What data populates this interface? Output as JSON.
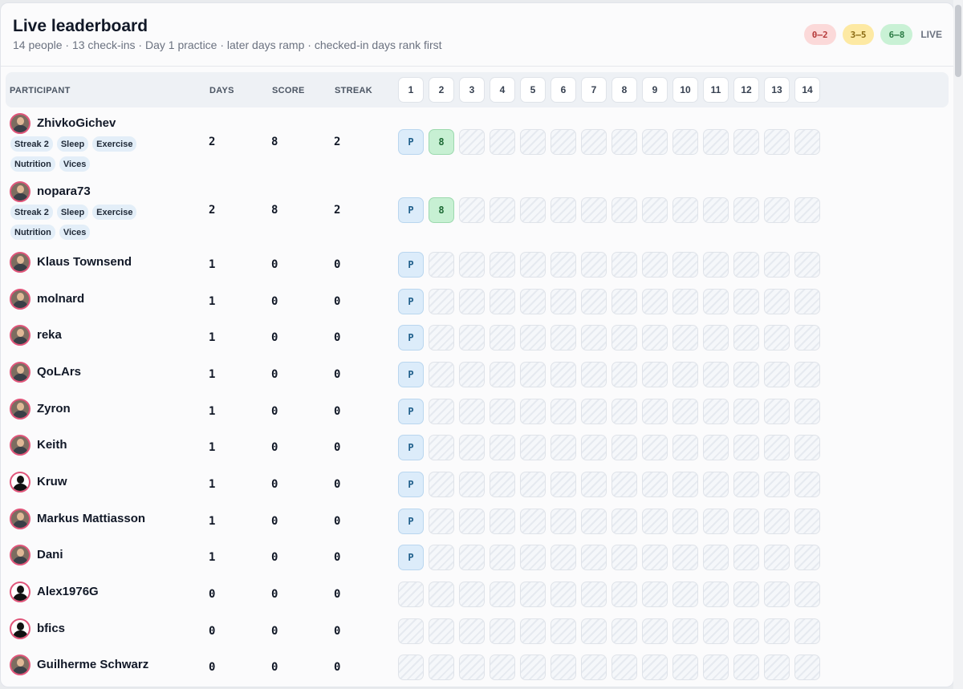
{
  "header": {
    "title": "Live leaderboard",
    "subtitle": "14 people · 13 check-ins · Day 1 practice · later days ramp · checked-in days rank first"
  },
  "legend": {
    "ranges": [
      {
        "label": "0–2",
        "color": "#fbd9d9"
      },
      {
        "label": "3–5",
        "color": "#fde9a3"
      },
      {
        "label": "6–8",
        "color": "#c9f1d5"
      }
    ],
    "live_label": "LIVE"
  },
  "columns": {
    "participant": "PARTICIPANT",
    "days": "DAYS",
    "score": "SCORE",
    "streak": "STREAK",
    "day_numbers": [
      "1",
      "2",
      "3",
      "4",
      "5",
      "6",
      "7",
      "8",
      "9",
      "10",
      "11",
      "12",
      "13",
      "14"
    ]
  },
  "participants": [
    {
      "name": "ZhivkoGichev",
      "days": "2",
      "score": "8",
      "streak": "2",
      "tags": [
        "Streak 2",
        "Sleep",
        "Exercise",
        "Nutrition",
        "Vices"
      ],
      "cells": [
        "P",
        "8"
      ],
      "avatar": "photo"
    },
    {
      "name": "nopara73",
      "days": "2",
      "score": "8",
      "streak": "2",
      "tags": [
        "Streak 2",
        "Sleep",
        "Exercise",
        "Nutrition",
        "Vices"
      ],
      "cells": [
        "P",
        "8"
      ],
      "avatar": "photo"
    },
    {
      "name": "Klaus Townsend",
      "days": "1",
      "score": "0",
      "streak": "0",
      "tags": [],
      "cells": [
        "P"
      ],
      "avatar": "photo"
    },
    {
      "name": "molnard",
      "days": "1",
      "score": "0",
      "streak": "0",
      "tags": [],
      "cells": [
        "P"
      ],
      "avatar": "photo"
    },
    {
      "name": "reka",
      "days": "1",
      "score": "0",
      "streak": "0",
      "tags": [],
      "cells": [
        "P"
      ],
      "avatar": "photo"
    },
    {
      "name": "QoLArs",
      "days": "1",
      "score": "0",
      "streak": "0",
      "tags": [],
      "cells": [
        "P"
      ],
      "avatar": "photo"
    },
    {
      "name": "Zyron",
      "days": "1",
      "score": "0",
      "streak": "0",
      "tags": [],
      "cells": [
        "P"
      ],
      "avatar": "photo"
    },
    {
      "name": "Keith",
      "days": "1",
      "score": "0",
      "streak": "0",
      "tags": [],
      "cells": [
        "P"
      ],
      "avatar": "photo"
    },
    {
      "name": "Kruw",
      "days": "1",
      "score": "0",
      "streak": "0",
      "tags": [],
      "cells": [
        "P"
      ],
      "avatar": "silhouette"
    },
    {
      "name": "Markus Mattiasson",
      "days": "1",
      "score": "0",
      "streak": "0",
      "tags": [],
      "cells": [
        "P"
      ],
      "avatar": "photo"
    },
    {
      "name": "Dani",
      "days": "1",
      "score": "0",
      "streak": "0",
      "tags": [],
      "cells": [
        "P"
      ],
      "avatar": "photo"
    },
    {
      "name": "Alex1976G",
      "days": "0",
      "score": "0",
      "streak": "0",
      "tags": [],
      "cells": [],
      "avatar": "silhouette"
    },
    {
      "name": "bfics",
      "days": "0",
      "score": "0",
      "streak": "0",
      "tags": [],
      "cells": [],
      "avatar": "silhouette"
    },
    {
      "name": "Guilherme Schwarz",
      "days": "0",
      "score": "0",
      "streak": "0",
      "tags": [],
      "cells": [],
      "avatar": "photo"
    }
  ]
}
